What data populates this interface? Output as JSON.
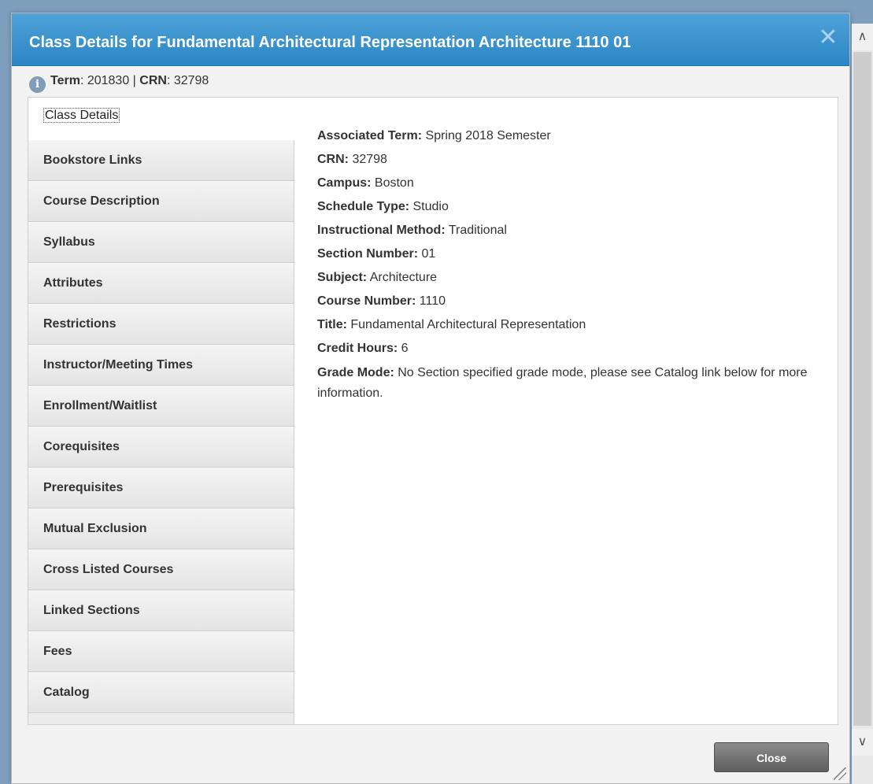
{
  "dialog": {
    "title": "Class Details for Fundamental Architectural Representation Architecture 1110 01",
    "close_glyph": "✕",
    "term_label": "Term",
    "term_value": ": 201830 | ",
    "crn_label": "CRN",
    "crn_value": ": 32798",
    "info_glyph": "i"
  },
  "tabs": [
    {
      "label": "Class Details",
      "active": true
    },
    {
      "label": "Bookstore Links"
    },
    {
      "label": "Course Description"
    },
    {
      "label": "Syllabus"
    },
    {
      "label": "Attributes"
    },
    {
      "label": "Restrictions"
    },
    {
      "label": "Instructor/Meeting Times"
    },
    {
      "label": "Enrollment/Waitlist"
    },
    {
      "label": "Corequisites"
    },
    {
      "label": "Prerequisites"
    },
    {
      "label": "Mutual Exclusion"
    },
    {
      "label": "Cross Listed Courses"
    },
    {
      "label": "Linked Sections"
    },
    {
      "label": "Fees"
    },
    {
      "label": "Catalog"
    }
  ],
  "details": [
    {
      "label": "Associated Term:",
      "value": " Spring 2018 Semester"
    },
    {
      "label": "CRN:",
      "value": " 32798"
    },
    {
      "label": "Campus:",
      "value": " Boston"
    },
    {
      "label": "Schedule Type:",
      "value": " Studio"
    },
    {
      "label": "Instructional Method:",
      "value": " Traditional"
    },
    {
      "label": "Section Number:",
      "value": " 01"
    },
    {
      "label": "Subject:",
      "value": " Architecture"
    },
    {
      "label": "Course Number:",
      "value": " 1110"
    },
    {
      "label": "Title:",
      "value": " Fundamental Architectural Representation"
    },
    {
      "label": "Credit Hours:",
      "value": " 6"
    },
    {
      "label": "Grade Mode:",
      "value": " No Section specified grade mode, please see Catalog link below for more information."
    }
  ],
  "footer": {
    "close_label": "Close"
  },
  "scrollbar": {
    "up_glyph": "∧",
    "down_glyph": "∨"
  }
}
